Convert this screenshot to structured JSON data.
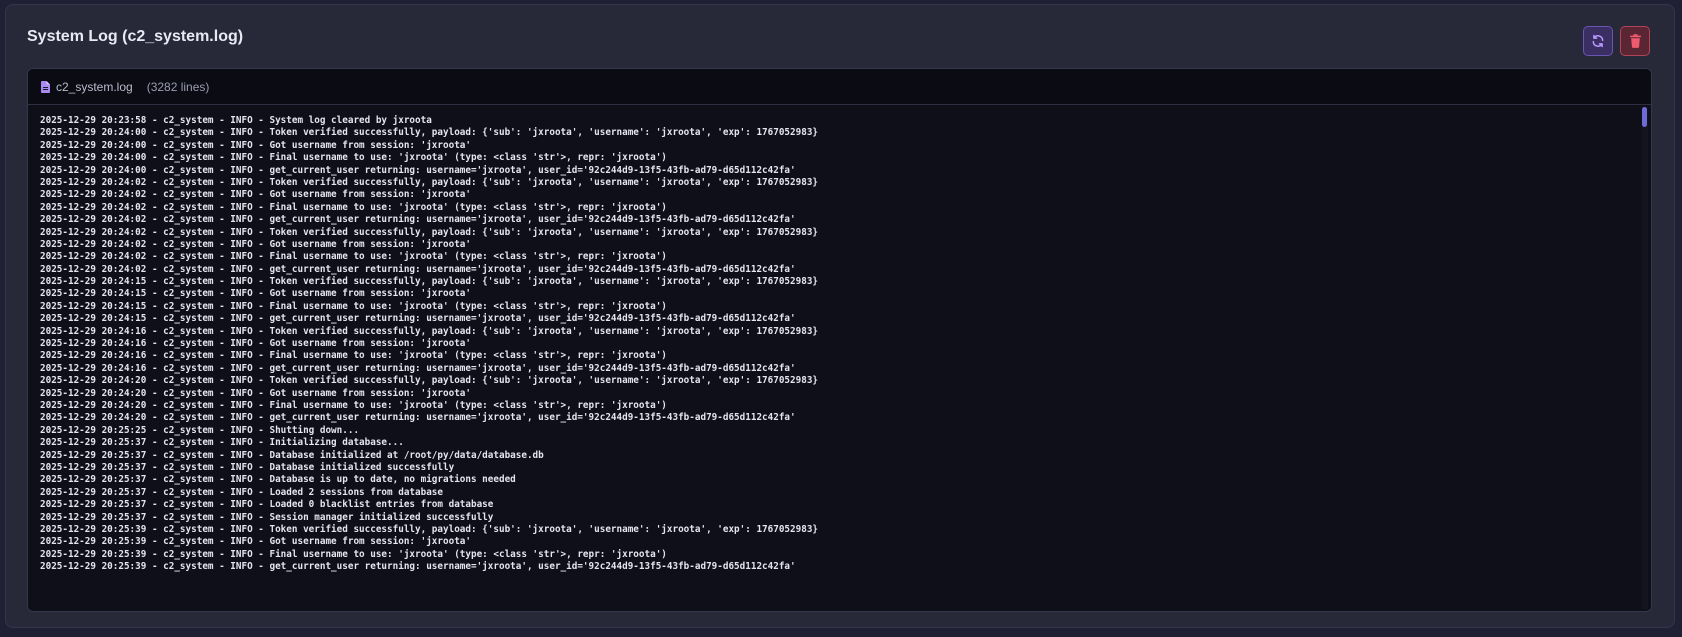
{
  "panel": {
    "title": "System Log (c2_system.log)"
  },
  "toolbar": {
    "refresh_icon": "refresh-icon",
    "delete_icon": "trash-icon"
  },
  "log": {
    "file_icon": "file-icon",
    "filename": "c2_system.log",
    "line_count": "(3282 lines)",
    "lines": [
      "2025-12-29 20:23:58 - c2_system - INFO - System log cleared by jxroota",
      "2025-12-29 20:24:00 - c2_system - INFO - Token verified successfully, payload: {'sub': 'jxroota', 'username': 'jxroota', 'exp': 1767052983}",
      "2025-12-29 20:24:00 - c2_system - INFO - Got username from session: 'jxroota'",
      "2025-12-29 20:24:00 - c2_system - INFO - Final username to use: 'jxroota' (type: <class 'str'>, repr: 'jxroota')",
      "2025-12-29 20:24:00 - c2_system - INFO - get_current_user returning: username='jxroota', user_id='92c244d9-13f5-43fb-ad79-d65d112c42fa'",
      "2025-12-29 20:24:02 - c2_system - INFO - Token verified successfully, payload: {'sub': 'jxroota', 'username': 'jxroota', 'exp': 1767052983}",
      "2025-12-29 20:24:02 - c2_system - INFO - Got username from session: 'jxroota'",
      "2025-12-29 20:24:02 - c2_system - INFO - Final username to use: 'jxroota' (type: <class 'str'>, repr: 'jxroota')",
      "2025-12-29 20:24:02 - c2_system - INFO - get_current_user returning: username='jxroota', user_id='92c244d9-13f5-43fb-ad79-d65d112c42fa'",
      "2025-12-29 20:24:02 - c2_system - INFO - Token verified successfully, payload: {'sub': 'jxroota', 'username': 'jxroota', 'exp': 1767052983}",
      "2025-12-29 20:24:02 - c2_system - INFO - Got username from session: 'jxroota'",
      "2025-12-29 20:24:02 - c2_system - INFO - Final username to use: 'jxroota' (type: <class 'str'>, repr: 'jxroota')",
      "2025-12-29 20:24:02 - c2_system - INFO - get_current_user returning: username='jxroota', user_id='92c244d9-13f5-43fb-ad79-d65d112c42fa'",
      "2025-12-29 20:24:15 - c2_system - INFO - Token verified successfully, payload: {'sub': 'jxroota', 'username': 'jxroota', 'exp': 1767052983}",
      "2025-12-29 20:24:15 - c2_system - INFO - Got username from session: 'jxroota'",
      "2025-12-29 20:24:15 - c2_system - INFO - Final username to use: 'jxroota' (type: <class 'str'>, repr: 'jxroota')",
      "2025-12-29 20:24:15 - c2_system - INFO - get_current_user returning: username='jxroota', user_id='92c244d9-13f5-43fb-ad79-d65d112c42fa'",
      "2025-12-29 20:24:16 - c2_system - INFO - Token verified successfully, payload: {'sub': 'jxroota', 'username': 'jxroota', 'exp': 1767052983}",
      "2025-12-29 20:24:16 - c2_system - INFO - Got username from session: 'jxroota'",
      "2025-12-29 20:24:16 - c2_system - INFO - Final username to use: 'jxroota' (type: <class 'str'>, repr: 'jxroota')",
      "2025-12-29 20:24:16 - c2_system - INFO - get_current_user returning: username='jxroota', user_id='92c244d9-13f5-43fb-ad79-d65d112c42fa'",
      "2025-12-29 20:24:20 - c2_system - INFO - Token verified successfully, payload: {'sub': 'jxroota', 'username': 'jxroota', 'exp': 1767052983}",
      "2025-12-29 20:24:20 - c2_system - INFO - Got username from session: 'jxroota'",
      "2025-12-29 20:24:20 - c2_system - INFO - Final username to use: 'jxroota' (type: <class 'str'>, repr: 'jxroota')",
      "2025-12-29 20:24:20 - c2_system - INFO - get_current_user returning: username='jxroota', user_id='92c244d9-13f5-43fb-ad79-d65d112c42fa'",
      "2025-12-29 20:25:25 - c2_system - INFO - Shutting down...",
      "2025-12-29 20:25:37 - c2_system - INFO - Initializing database...",
      "2025-12-29 20:25:37 - c2_system - INFO - Database initialized at /root/py/data/database.db",
      "2025-12-29 20:25:37 - c2_system - INFO - Database initialized successfully",
      "2025-12-29 20:25:37 - c2_system - INFO - Database is up to date, no migrations needed",
      "2025-12-29 20:25:37 - c2_system - INFO - Loaded 2 sessions from database",
      "2025-12-29 20:25:37 - c2_system - INFO - Loaded 0 blacklist entries from database",
      "2025-12-29 20:25:37 - c2_system - INFO - Session manager initialized successfully",
      "2025-12-29 20:25:39 - c2_system - INFO - Token verified successfully, payload: {'sub': 'jxroota', 'username': 'jxroota', 'exp': 1767052983}",
      "2025-12-29 20:25:39 - c2_system - INFO - Got username from session: 'jxroota'",
      "2025-12-29 20:25:39 - c2_system - INFO - Final username to use: 'jxroota' (type: <class 'str'>, repr: 'jxroota')",
      "2025-12-29 20:25:39 - c2_system - INFO - get_current_user returning: username='jxroota', user_id='92c244d9-13f5-43fb-ad79-d65d112c42fa'"
    ]
  },
  "colors": {
    "accent": "#6f6bd6",
    "danger": "#ef5b6e",
    "file_icon": "#a98af0"
  }
}
